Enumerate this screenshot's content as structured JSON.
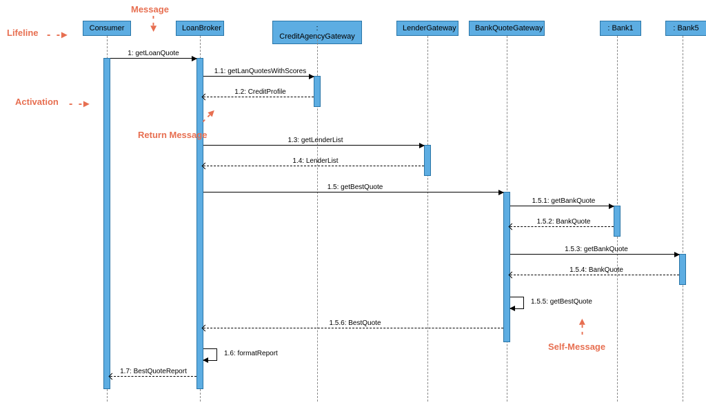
{
  "participants": {
    "consumer": "Consumer",
    "loanBroker": "LoanBroker",
    "creditAgency": ": CreditAgencyGateway",
    "lenderGateway": "LenderGateway",
    "bankQuoteGateway": "BankQuoteGateway",
    "bank1": ": Bank1",
    "bank5": ": Bank5"
  },
  "messages": {
    "m1": "1: getLoanQuote",
    "m11": "1.1: getLanQuotesWithScores",
    "m12": "1.2: CreditProfile",
    "m13": "1.3: getLenderList",
    "m14": "1.4: LenderList",
    "m15": "1.5: getBestQuote",
    "m151": "1.5.1: getBankQuote",
    "m152": "1.5.2: BankQuote",
    "m153": "1.5.3: getBankQuote",
    "m154": "1.5.4: BankQuote",
    "m155": "1.5.5: getBestQuote",
    "m156": "1.5.6: BestQuote",
    "m16": "1.6: formatReport",
    "m17": "1.7: BestQuoteReport"
  },
  "annotations": {
    "lifeline": "Lifeline",
    "message": "Message",
    "activation": "Activation",
    "returnMessage": "Return Message",
    "selfMessage": "Self-Message"
  },
  "chart_data": {
    "type": "sequence-diagram",
    "participants": [
      "Consumer",
      "LoanBroker",
      ": CreditAgencyGateway",
      "LenderGateway",
      "BankQuoteGateway",
      ": Bank1",
      ": Bank5"
    ],
    "messages": [
      {
        "seq": "1",
        "from": "Consumer",
        "to": "LoanBroker",
        "label": "getLoanQuote",
        "kind": "sync"
      },
      {
        "seq": "1.1",
        "from": "LoanBroker",
        "to": ": CreditAgencyGateway",
        "label": "getLanQuotesWithScores",
        "kind": "sync"
      },
      {
        "seq": "1.2",
        "from": ": CreditAgencyGateway",
        "to": "LoanBroker",
        "label": "CreditProfile",
        "kind": "return"
      },
      {
        "seq": "1.3",
        "from": "LoanBroker",
        "to": "LenderGateway",
        "label": "getLenderList",
        "kind": "sync"
      },
      {
        "seq": "1.4",
        "from": "LenderGateway",
        "to": "LoanBroker",
        "label": "LenderList",
        "kind": "return"
      },
      {
        "seq": "1.5",
        "from": "LoanBroker",
        "to": "BankQuoteGateway",
        "label": "getBestQuote",
        "kind": "sync"
      },
      {
        "seq": "1.5.1",
        "from": "BankQuoteGateway",
        "to": ": Bank1",
        "label": "getBankQuote",
        "kind": "sync"
      },
      {
        "seq": "1.5.2",
        "from": ": Bank1",
        "to": "BankQuoteGateway",
        "label": "BankQuote",
        "kind": "return"
      },
      {
        "seq": "1.5.3",
        "from": "BankQuoteGateway",
        "to": ": Bank5",
        "label": "getBankQuote",
        "kind": "sync"
      },
      {
        "seq": "1.5.4",
        "from": ": Bank5",
        "to": "BankQuoteGateway",
        "label": "BankQuote",
        "kind": "return"
      },
      {
        "seq": "1.5.5",
        "from": "BankQuoteGateway",
        "to": "BankQuoteGateway",
        "label": "getBestQuote",
        "kind": "self"
      },
      {
        "seq": "1.5.6",
        "from": "BankQuoteGateway",
        "to": "LoanBroker",
        "label": "BestQuote",
        "kind": "return"
      },
      {
        "seq": "1.6",
        "from": "LoanBroker",
        "to": "LoanBroker",
        "label": "formatReport",
        "kind": "self"
      },
      {
        "seq": "1.7",
        "from": "LoanBroker",
        "to": "Consumer",
        "label": "BestQuoteReport",
        "kind": "return"
      }
    ],
    "annotations": [
      {
        "label": "Lifeline",
        "points_to": "Consumer participant box"
      },
      {
        "label": "Message",
        "points_to": "1: getLoanQuote"
      },
      {
        "label": "Activation",
        "points_to": "Consumer activation bar"
      },
      {
        "label": "Return Message",
        "points_to": "1.2: CreditProfile"
      },
      {
        "label": "Self-Message",
        "points_to": "1.5.5: getBestQuote"
      }
    ]
  }
}
